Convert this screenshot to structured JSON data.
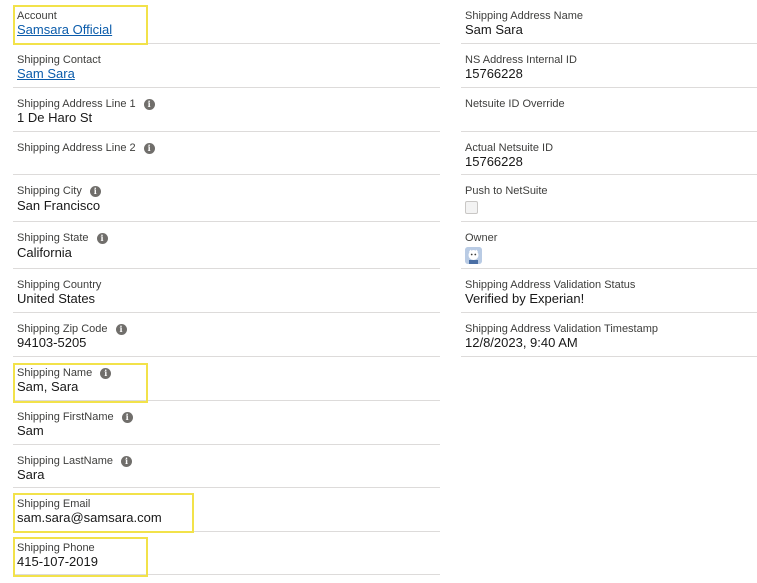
{
  "left_fields": [
    {
      "label": "Account",
      "value": "Samsara Official",
      "link": true,
      "info": false
    },
    {
      "label": "Shipping Contact",
      "value": "Sam Sara",
      "link": true,
      "info": false
    },
    {
      "label": "Shipping Address Line 1",
      "value": "1 De Haro St",
      "link": false,
      "info": true
    },
    {
      "label": "Shipping Address Line 2",
      "value": "",
      "link": false,
      "info": true
    },
    {
      "label": "Shipping City",
      "value": "San Francisco",
      "link": false,
      "info": true
    },
    {
      "label": "Shipping State",
      "value": "California",
      "link": false,
      "info": true
    },
    {
      "label": "Shipping Country",
      "value": "United States",
      "link": false,
      "info": false
    },
    {
      "label": "Shipping Zip Code",
      "value": "94103-5205",
      "link": false,
      "info": true
    },
    {
      "label": "Shipping Name",
      "value": "Sam, Sara",
      "link": false,
      "info": true
    },
    {
      "label": "Shipping FirstName",
      "value": "Sam",
      "link": false,
      "info": true
    },
    {
      "label": "Shipping LastName",
      "value": "Sara",
      "link": false,
      "info": true
    },
    {
      "label": "Shipping Email",
      "value": "sam.sara@samsara.com",
      "link": false,
      "info": false
    },
    {
      "label": "Shipping Phone",
      "value": "415-107-2019",
      "link": false,
      "info": false
    }
  ],
  "right_fields": [
    {
      "label": "Shipping Address Name",
      "value": "Sam Sara"
    },
    {
      "label": "NS Address Internal ID",
      "value": "15766228"
    },
    {
      "label": "Netsuite ID Override",
      "value": ""
    },
    {
      "label": "Actual Netsuite ID",
      "value": "15766228"
    },
    {
      "label": "Push to NetSuite",
      "value": "",
      "control": "checkbox",
      "checked": false
    },
    {
      "label": "Owner",
      "value": "",
      "control": "avatar"
    },
    {
      "label": "Shipping Address Validation Status",
      "value": "Verified by Experian!"
    },
    {
      "label": "Shipping Address Validation Timestamp",
      "value": "12/8/2023, 9:40 AM"
    }
  ],
  "icons": {
    "info": "info-icon",
    "owner": "user-avatar-icon"
  },
  "colors": {
    "link": "#0b5cab",
    "highlight": "#f2e24a",
    "divider": "#dddbda"
  }
}
